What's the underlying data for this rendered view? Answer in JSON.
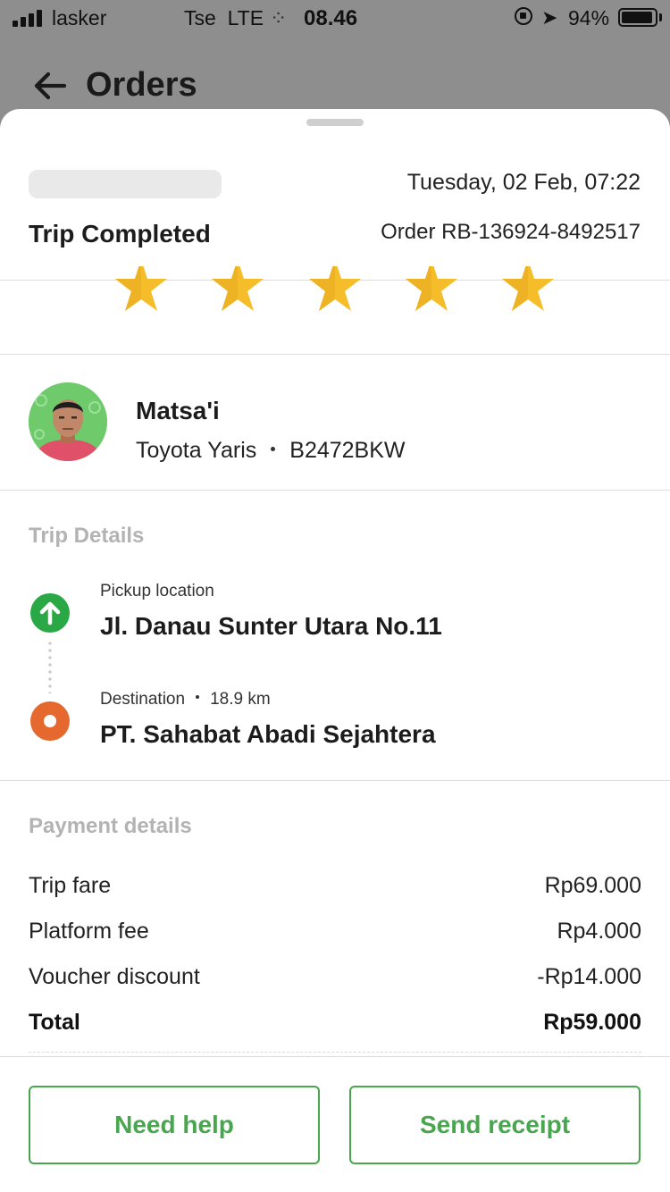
{
  "status_bar": {
    "carrier": "lasker",
    "carrier_2": "Tse",
    "network": "LTE",
    "loading_glyph": "⁘",
    "time": "08.46",
    "battery_percent": "94%",
    "battery_level": 0.94,
    "icons": [
      "signal-icon",
      "rotation-lock-icon",
      "location-arrow-icon",
      "battery-icon"
    ]
  },
  "header": {
    "title": "Orders",
    "back_icon": "arrow-left-icon"
  },
  "order": {
    "date": "Tuesday, 02 Feb, 07:22",
    "status": "Trip Completed",
    "order_id": "Order RB-136924-8492517",
    "rating_stars": 5
  },
  "driver": {
    "name": "Matsa'i",
    "vehicle": "Toyota Yaris",
    "plate": "B2472BKW"
  },
  "trip_details": {
    "title": "Trip Details",
    "pickup": {
      "label": "Pickup location",
      "value": "Jl. Danau Sunter Utara No.11"
    },
    "destination": {
      "label": "Destination",
      "distance": "18.9 km",
      "value": "PT. Sahabat Abadi Sejahtera"
    }
  },
  "payment": {
    "title": "Payment details",
    "rows": [
      {
        "label": "Trip fare",
        "value": "Rp69.000"
      },
      {
        "label": "Platform fee",
        "value": "Rp4.000"
      },
      {
        "label": "Voucher discount",
        "value": "-Rp14.000"
      }
    ],
    "total": {
      "label": "Total",
      "value": "Rp59.000"
    }
  },
  "actions": {
    "help": "Need help",
    "receipt": "Send receipt"
  },
  "colors": {
    "accent_green": "#48a64f",
    "star": "#f6bd2b",
    "pickup": "#2aa845",
    "destination": "#e5692f"
  }
}
